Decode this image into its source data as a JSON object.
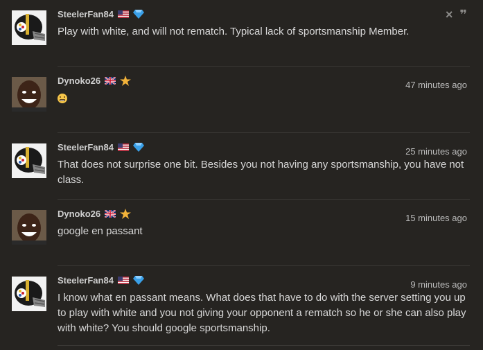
{
  "comments": [
    {
      "username": "SteelerFan84",
      "flag": "us",
      "badge": "diamond",
      "time": "",
      "text": "Play with white, and will not rematch. Typical lack of sportsmanship Member.",
      "avatar": "steelers-helmet"
    },
    {
      "username": "Dynoko26",
      "flag": "gb",
      "badge": "star",
      "time": "47 minutes ago",
      "text": "",
      "emoji": "grimacing-face",
      "avatar": "man-smiling"
    },
    {
      "username": "SteelerFan84",
      "flag": "us",
      "badge": "diamond",
      "time": "25 minutes ago",
      "text": "That does not surprise one bit. Besides you not having any sportsmanship, you have not class.",
      "avatar": "steelers-helmet"
    },
    {
      "username": "Dynoko26",
      "flag": "gb",
      "badge": "star",
      "time": "15 minutes ago",
      "text": "google en passant",
      "avatar": "man-smiling"
    },
    {
      "username": "SteelerFan84",
      "flag": "us",
      "badge": "diamond",
      "time": "9 minutes ago",
      "text": "I know what en passant means. What does that have to do with the server setting you up to play with white and you not giving your opponent a rematch so he or she can also play with white? You should google sportsmanship.",
      "avatar": "steelers-helmet"
    }
  ],
  "actions": {
    "close_icon": "×",
    "quote_icon": "❞"
  },
  "colors": {
    "background": "#262421",
    "diamond": "#3aa0e8",
    "star": "#f3b33a"
  }
}
